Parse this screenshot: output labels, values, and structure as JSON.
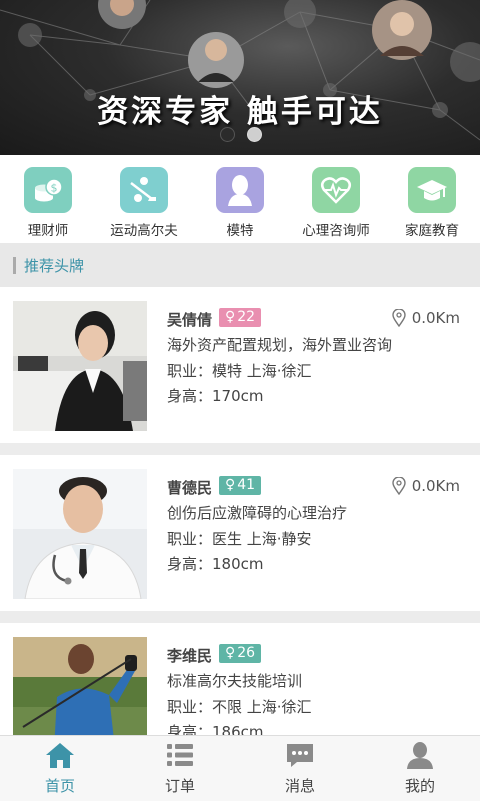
{
  "banner": {
    "title": "资深专家 触手可达",
    "page_count": 2,
    "active_index": 1
  },
  "categories": [
    {
      "label": "理财师",
      "icon": "coins-icon",
      "color": "#7fcfbf"
    },
    {
      "label": "运动高尔夫",
      "icon": "golf-icon",
      "color": "#7fcfcf"
    },
    {
      "label": "模特",
      "icon": "person-icon",
      "color": "#a9a3e0"
    },
    {
      "label": "心理咨询师",
      "icon": "heartbeat-icon",
      "color": "#8fd6a3"
    },
    {
      "label": "家庭教育",
      "icon": "graduation-cap-icon",
      "color": "#8fd6a3"
    }
  ],
  "section": {
    "title": "推荐头牌"
  },
  "experts": [
    {
      "name": "吴倩倩",
      "gender": "female",
      "age": "22",
      "distance": "0.0Km",
      "desc": "海外资产配置规划，海外置业咨询",
      "job": "职业：模特  上海·徐汇",
      "height": "身高：170cm"
    },
    {
      "name": "曹德民",
      "gender": "female",
      "age": "41",
      "distance": "0.0Km",
      "desc": "创伤后应激障碍的心理治疗",
      "job": "职业：医生  上海·静安",
      "height": "身高：180cm"
    },
    {
      "name": "李维民",
      "gender": "female",
      "age": "26",
      "distance": "",
      "desc": "标准高尔夫技能培训",
      "job": "职业：不限  上海·徐汇",
      "height": "身高：186cm"
    }
  ],
  "tabs": [
    {
      "label": "首页",
      "icon": "home-icon",
      "active": true
    },
    {
      "label": "订单",
      "icon": "list-icon",
      "active": false
    },
    {
      "label": "消息",
      "icon": "message-icon",
      "active": false
    },
    {
      "label": "我的",
      "icon": "user-icon",
      "active": false
    }
  ],
  "colors": {
    "accent": "#3d93a8",
    "female_badge": "#e98fb0",
    "male_badge": "#5fb5a6"
  }
}
